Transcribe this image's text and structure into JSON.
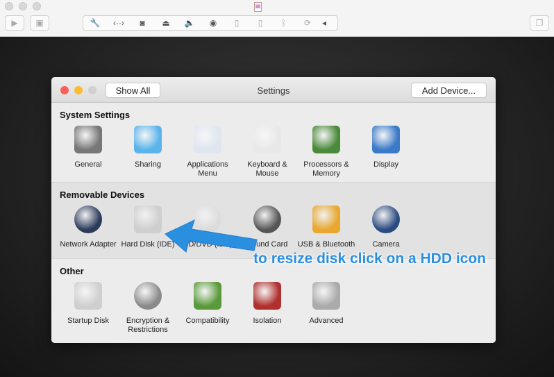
{
  "toolbar": {
    "icons": [
      "wrench-icon",
      "network-icon",
      "hard-disk-icon",
      "cd-icon",
      "sound-icon",
      "camera-icon",
      "usb-icon",
      "usb-icon",
      "bluetooth-icon",
      "shared-folder-icon",
      "chevron-left-icon"
    ]
  },
  "window": {
    "title": "Settings",
    "show_all": "Show All",
    "add_device": "Add Device..."
  },
  "sections": [
    {
      "title": "System Settings",
      "items": [
        {
          "label": "General",
          "color": "#777"
        },
        {
          "label": "Sharing",
          "color": "#5ab4ea"
        },
        {
          "label": "Applications Menu",
          "color": "#dfe6f0"
        },
        {
          "label": "Keyboard & Mouse",
          "color": "#e8e8e8"
        },
        {
          "label": "Processors & Memory",
          "color": "#4a8a3a"
        },
        {
          "label": "Display",
          "color": "#3a7ac8"
        }
      ]
    },
    {
      "title": "Removable Devices",
      "items": [
        {
          "label": "Network Adapter",
          "color": "#2c3a5a"
        },
        {
          "label": "Hard Disk (IDE)",
          "color": "#cfcfcf"
        },
        {
          "label": "CD/DVD (IDE)",
          "color": "#dcdcdc"
        },
        {
          "label": "Sound Card",
          "color": "#555"
        },
        {
          "label": "USB & Bluetooth",
          "color": "#e8a830"
        },
        {
          "label": "Camera",
          "color": "#2a4a80"
        }
      ]
    },
    {
      "title": "Other",
      "items": [
        {
          "label": "Startup Disk",
          "color": "#cfcfcf"
        },
        {
          "label": "Encryption & Restrictions",
          "color": "#8a8a8a"
        },
        {
          "label": "Compatibility",
          "color": "#5a9a3a"
        },
        {
          "label": "Isolation",
          "color": "#b03030"
        },
        {
          "label": "Advanced",
          "color": "#aaaaaa"
        }
      ]
    }
  ],
  "annotation": {
    "text": "to resize disk click on a HDD icon",
    "color": "#2b8fe0"
  }
}
